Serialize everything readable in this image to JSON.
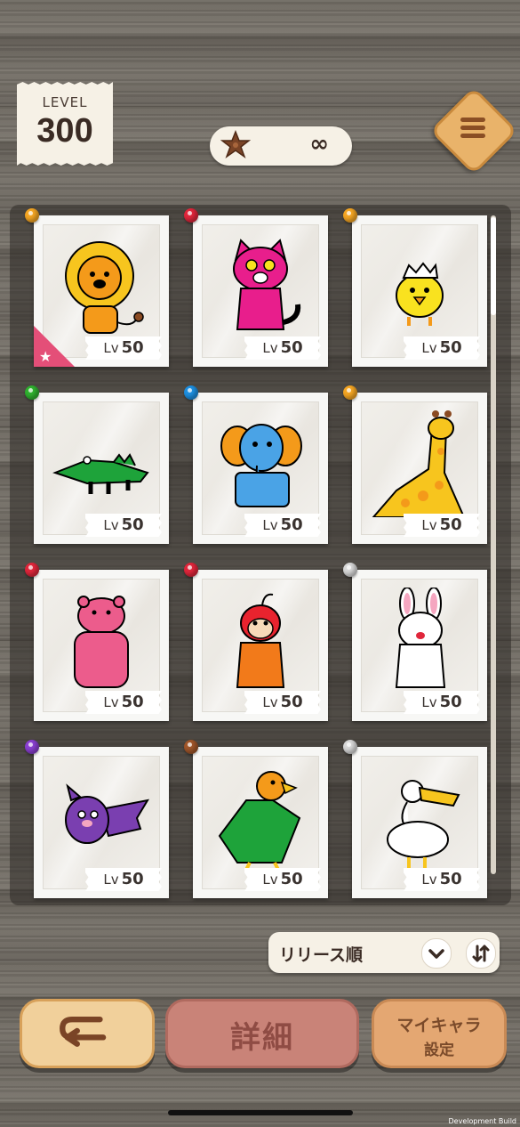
{
  "header": {
    "level_label": "LEVEL",
    "level_value": "300",
    "currency_value": "∞",
    "currency_icon": "cookie-star-icon",
    "menu_icon": "hamburger-menu-icon"
  },
  "grid": {
    "cards": [
      {
        "name": "lion",
        "pin_color": "#f5a623",
        "level_prefix": "Lv",
        "level": "50",
        "favorite": true
      },
      {
        "name": "cat",
        "pin_color": "#e0263b",
        "level_prefix": "Lv",
        "level": "50",
        "favorite": false
      },
      {
        "name": "chick",
        "pin_color": "#f5a623",
        "level_prefix": "Lv",
        "level": "50",
        "favorite": false
      },
      {
        "name": "crocodile",
        "pin_color": "#2fb12f",
        "level_prefix": "Lv",
        "level": "50",
        "favorite": false
      },
      {
        "name": "elephant",
        "pin_color": "#1d8fe0",
        "level_prefix": "Lv",
        "level": "50",
        "favorite": false
      },
      {
        "name": "giraffe",
        "pin_color": "#f5a623",
        "level_prefix": "Lv",
        "level": "50",
        "favorite": false
      },
      {
        "name": "hippo",
        "pin_color": "#e0263b",
        "level_prefix": "Lv",
        "level": "50",
        "favorite": false
      },
      {
        "name": "monkey",
        "pin_color": "#e0263b",
        "level_prefix": "Lv",
        "level": "50",
        "favorite": false
      },
      {
        "name": "rabbit",
        "pin_color": "#d8d8d8",
        "level_prefix": "Lv",
        "level": "50",
        "favorite": false
      },
      {
        "name": "bat",
        "pin_color": "#8a3fd1",
        "level_prefix": "Lv",
        "level": "50",
        "favorite": false
      },
      {
        "name": "eagle",
        "pin_color": "#a0562a",
        "level_prefix": "Lv",
        "level": "50",
        "favorite": false
      },
      {
        "name": "pelican",
        "pin_color": "#d8d8d8",
        "level_prefix": "Lv",
        "level": "50",
        "favorite": false
      }
    ]
  },
  "sort": {
    "label": "リリース順",
    "dropdown_icon": "chevron-down-icon",
    "order_icon": "sort-order-icon"
  },
  "bottom_bar": {
    "back_icon": "return-arrow-icon",
    "detail_label": "詳細",
    "mychar_line1": "マイキャラ",
    "mychar_line2": "設定"
  },
  "footer": {
    "dev_build": "Development Build"
  }
}
